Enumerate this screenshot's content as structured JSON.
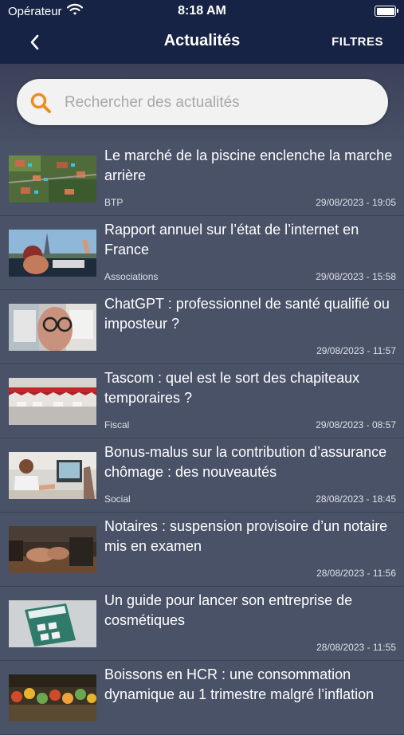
{
  "status": {
    "carrier": "Opérateur",
    "time": "8:18 AM"
  },
  "nav": {
    "title": "Actualités",
    "filters_label": "FILTRES"
  },
  "search": {
    "placeholder": "Rechercher des actualités"
  },
  "news": [
    {
      "title": "Le marché de la piscine enclenche la marche arrière",
      "category": "BTP",
      "date": "29/08/2023 - 19:05"
    },
    {
      "title": "Rapport annuel sur l’état de l’internet en France",
      "category": "Associations",
      "date": "29/08/2023 - 15:58"
    },
    {
      "title": "ChatGPT : professionnel de santé qualifié ou imposteur ?",
      "category": "",
      "date": "29/08/2023 - 11:57"
    },
    {
      "title": "Tascom : quel est le sort des chapiteaux temporaires ?",
      "category": "Fiscal",
      "date": "29/08/2023 - 08:57"
    },
    {
      "title": "Bonus-malus sur la contribution d’assurance chômage : des nouveautés",
      "category": "Social",
      "date": "28/08/2023 - 18:45"
    },
    {
      "title": "Notaires : suspension provisoire d’un notaire mis en examen",
      "category": "",
      "date": "28/08/2023 - 11:56"
    },
    {
      "title": "Un guide pour lancer son entreprise de cosmétiques",
      "category": "",
      "date": "28/08/2023 - 11:55"
    },
    {
      "title": "Boissons en HCR : une consommation dynamique au 1 trimestre malgré l’inflation",
      "category": "",
      "date": ""
    }
  ]
}
